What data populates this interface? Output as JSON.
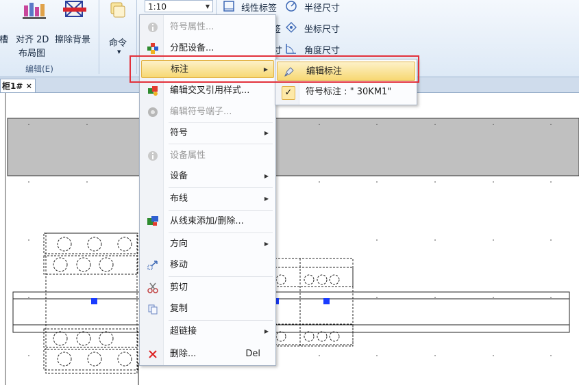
{
  "ribbon": {
    "left_cut_label": "線槽",
    "align_label": "对齐 2D",
    "align_label2": "布局图",
    "erase_bg_label": "擦除背景",
    "group_label": "编辑(E)",
    "command_label": "命令",
    "scale_value": "1:10",
    "dim_linear": "线性标签",
    "dim_radius": "半径尺寸",
    "dim_coord": "坐标尺寸",
    "dim_angle": "角度尺寸",
    "dim_partial_1": "签",
    "dim_partial_2": "寸"
  },
  "tab": {
    "doc_title": "柜1#",
    "close_glyph": "×"
  },
  "context_menu": {
    "items": [
      {
        "label": "符号属性...",
        "icon": "info-icon",
        "disabled": true
      },
      {
        "label": "分配设备...",
        "icon": "assign-device-icon",
        "disabled": false
      },
      {
        "label": "标注",
        "icon": "",
        "submenu": true
      },
      {
        "label": "编辑交叉引用样式...",
        "icon": "cross-ref-icon",
        "disabled": false
      },
      {
        "label": "编辑符号端子...",
        "icon": "terminal-icon",
        "disabled": true
      },
      {
        "label": "符号",
        "submenu": true
      },
      {
        "label": "设备属性",
        "icon": "info-icon",
        "disabled": true
      },
      {
        "label": "设备",
        "submenu": true
      },
      {
        "label": "布线",
        "submenu": true
      },
      {
        "label": "从线束添加/删除...",
        "icon": "harness-icon"
      },
      {
        "label": "方向",
        "submenu": true
      },
      {
        "label": "移动",
        "icon": "move-icon"
      },
      {
        "label": "剪切",
        "icon": "scissors-icon"
      },
      {
        "label": "复制",
        "icon": "copy-icon"
      },
      {
        "label": "超链接",
        "submenu": true
      },
      {
        "label": "删除...",
        "icon": "delete-icon",
        "shortcut": "Del"
      }
    ]
  },
  "submenu": {
    "items": [
      {
        "label": "编辑标注",
        "icon": "edit-annotation-icon"
      },
      {
        "label": "符号标注 : \" 30KM1\"",
        "checked": true
      }
    ],
    "check_glyph": "✓"
  },
  "colors": {
    "highlight": "#f7d873",
    "annotation_box": "#e2303a",
    "marker_blue": "#1a3cff"
  }
}
